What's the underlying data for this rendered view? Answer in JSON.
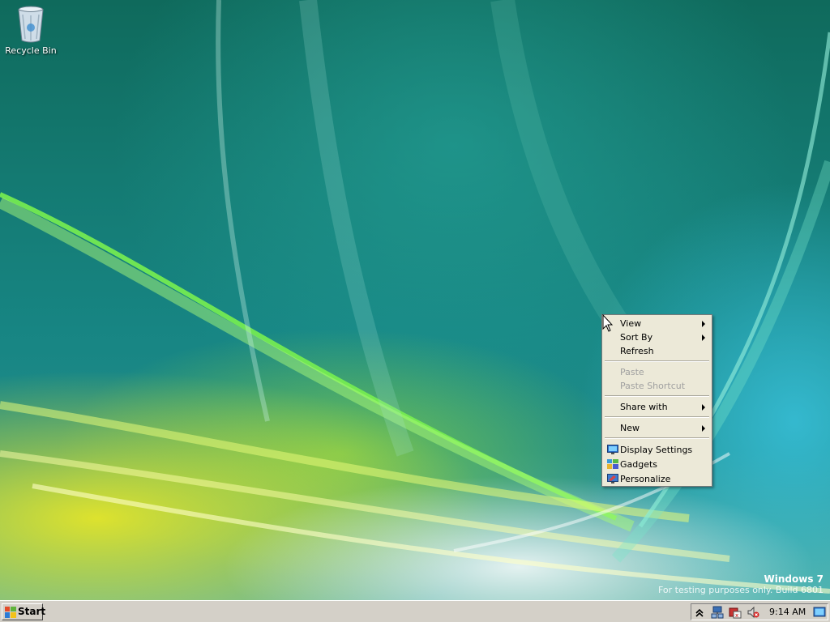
{
  "desktop": {
    "icons": [
      {
        "label": "Recycle Bin",
        "icon": "recycle-bin-icon"
      }
    ],
    "watermark": {
      "brand": "Windows 7",
      "build": "For testing purposes only. Build 6801"
    }
  },
  "context_menu": {
    "items": [
      {
        "label": "View",
        "submenu": true
      },
      {
        "label": "Sort By",
        "submenu": true
      },
      {
        "label": "Refresh"
      },
      {
        "label": "Paste",
        "disabled": true
      },
      {
        "label": "Paste Shortcut",
        "disabled": true
      },
      {
        "label": "Share with",
        "submenu": true
      },
      {
        "label": "New",
        "submenu": true
      },
      {
        "label": "Display Settings",
        "icon": "display-settings-icon"
      },
      {
        "label": "Gadgets",
        "icon": "gadgets-icon"
      },
      {
        "label": "Personalize",
        "icon": "personalize-icon"
      }
    ]
  },
  "taskbar": {
    "start_label": "Start",
    "tray_icons": [
      "show-hidden-icons-chevron",
      "network-icon",
      "action-center-icon",
      "volume-muted-icon",
      "show-desktop-icon"
    ],
    "clock": "9:14 AM"
  },
  "colors": {
    "menu_bg": "#ece9d8",
    "taskbar_bg": "#d4d0c8",
    "disabled_text": "#a0a0a0"
  }
}
